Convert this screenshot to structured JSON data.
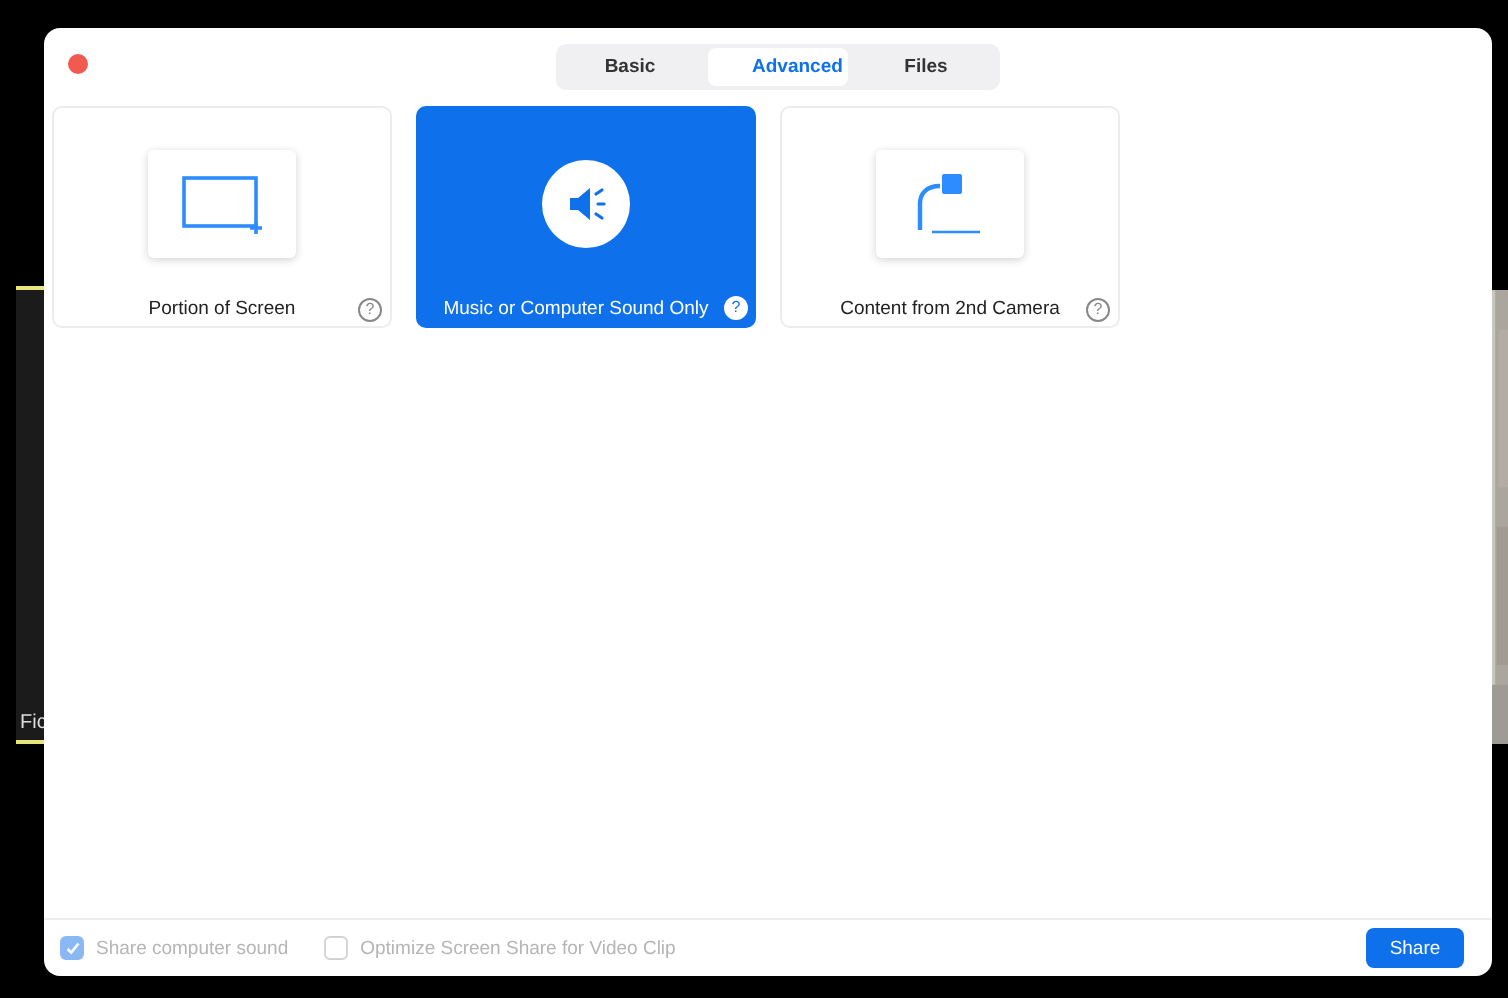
{
  "background_tiles": [
    {
      "kind": "video",
      "label": "Fic"
    },
    {
      "kind": "picture"
    }
  ],
  "tabs": [
    {
      "label": "Basic",
      "selected": false
    },
    {
      "label": "Advanced",
      "selected": true
    },
    {
      "label": "Files",
      "selected": false
    }
  ],
  "options": [
    {
      "kind": "region",
      "label": "Portion of Screen",
      "help": "?",
      "selected": false
    },
    {
      "kind": "sound",
      "label": "Music or Computer Sound Only",
      "help": "?",
      "selected": true
    },
    {
      "kind": "camera",
      "label": "Content from 2nd Camera",
      "help": "?",
      "selected": false
    }
  ],
  "footer_options": [
    {
      "label": "Share computer sound",
      "checked": true,
      "disabled": true
    },
    {
      "label": "Optimize Screen Share for Video Clip",
      "checked": false,
      "disabled": true
    }
  ],
  "share_button": "Share"
}
